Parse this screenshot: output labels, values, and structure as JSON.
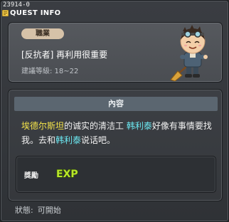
{
  "window": {
    "quest_id": "23914-0",
    "title": "QUEST INFO"
  },
  "header": {
    "category": "職業",
    "quest_name": "[反抗者] 再利用很重要",
    "recommended_level": "建議等級: 18~22",
    "npc_icon": "npc-sprite-icon"
  },
  "content": {
    "heading": "內容",
    "description": {
      "seg1": "埃德尔斯坦",
      "seg2": "的诚实的清洁工 ",
      "seg3": "韩利泰",
      "seg4": "好像有事情要找我。去和",
      "seg5": "韩利泰",
      "seg6": "说话吧。"
    },
    "reward": {
      "label": "獎勵",
      "exp_text": "EXP"
    }
  },
  "status": {
    "label": "狀態:",
    "value": "可開始"
  },
  "colors": {
    "highlight_place": "#f4e34a",
    "highlight_npc": "#6be7f0",
    "badge_bg": "#d6c2a8",
    "exp_green": "#b9e62a"
  }
}
